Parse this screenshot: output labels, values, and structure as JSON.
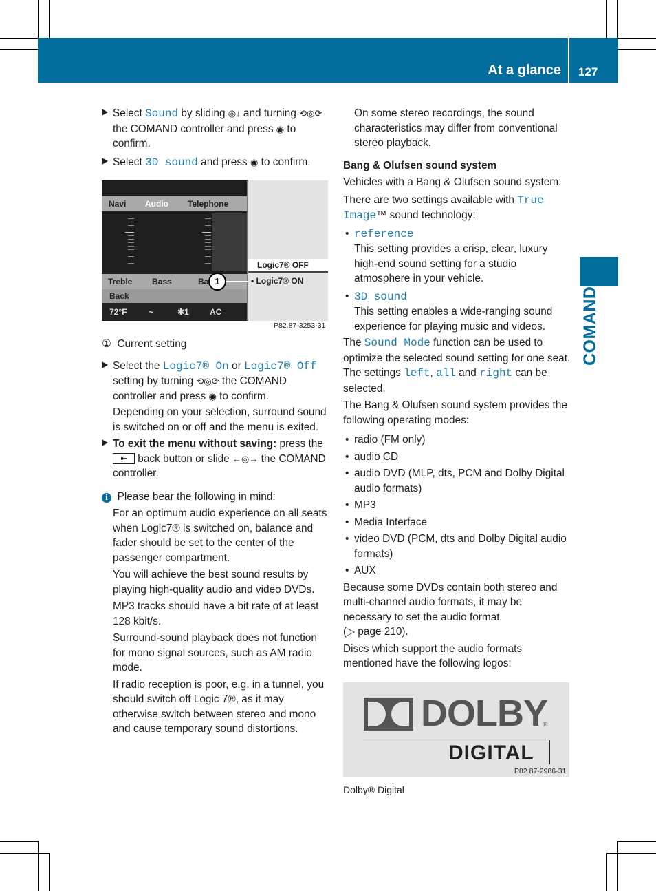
{
  "header": {
    "section_title": "At a glance",
    "page_number": "127",
    "side_tab_label": "COMAND",
    "accent_color": "#036d9d"
  },
  "left_column": {
    "step1": {
      "pre": "Select ",
      "link": "Sound",
      "mid": " by sliding ",
      "post": " and turning ",
      "post2": " the COMAND controller and press ",
      "post3": " to confirm."
    },
    "step2": {
      "pre": "Select ",
      "link": "3D sound",
      "post": " and press ",
      "post2": " to confirm."
    },
    "figure": {
      "tabs": [
        "Navi",
        "Audio",
        "Telephone"
      ],
      "bottom_menu": [
        "Treble",
        "Bass",
        "Bal/Fa"
      ],
      "back_label": "Back",
      "climate": [
        "72°F",
        "~",
        "✱1",
        "AC"
      ],
      "options": [
        "Logic7® OFF",
        "• Logic7® ON"
      ],
      "callout": "1",
      "code": "P82.87-3253-31"
    },
    "legend": {
      "num": "①",
      "text": "Current setting"
    },
    "step3": {
      "pre": "Select the ",
      "link1": "Logic7® On",
      "mid": " or ",
      "link2": "Logic7® Off",
      "post": " setting by turning ",
      "post2": " the COMAND controller and press ",
      "post3": " to confirm.",
      "para": "Depending on your selection, surround sound is switched on or off and the menu is exited."
    },
    "step4": {
      "bold": "To exit the menu without saving:",
      "pre": " press the ",
      "post": " back button or slide ",
      "post2": " the COMAND controller."
    },
    "info": {
      "heading": "Please bear the following in mind:",
      "paragraphs": [
        "For an optimum audio experience on all seats when Logic7® is switched on, balance and fader should be set to the center of the passenger compartment.",
        "You will achieve the best sound results by playing high-quality audio and video DVDs.",
        "MP3 tracks should have a bit rate of at least 128 kbit/s.",
        "Surround-sound playback does not function for mono signal sources, such as AM radio mode.",
        "If radio reception is poor, e.g. in a tunnel, you should switch off Logic 7®, as it may otherwise switch between stereo and mono and cause temporary sound distortions."
      ]
    }
  },
  "right_column": {
    "intro": "On some stereo recordings, the sound characteristics may differ from conventional stereo playback.",
    "heading": "Bang & Olufsen sound system",
    "vehicles": "Vehicles with a Bang & Olufsen sound system:",
    "two_settings": {
      "pre": "There are two settings available with ",
      "link": "True Image",
      "post": "™ sound technology:"
    },
    "settings": [
      {
        "name": "reference",
        "desc": "This setting provides a crisp, clear, luxury high-end sound setting for a studio atmosphere in your vehicle."
      },
      {
        "name": "3D sound",
        "desc": "This setting enables a wide-ranging sound experience for playing music and videos."
      }
    ],
    "sound_mode": {
      "pre": "The ",
      "link": "Sound Mode",
      "mid": " function can be used to optimize the selected sound setting for one seat. The settings ",
      "l1": "left",
      "c": ", ",
      "l2": "all",
      "and": " and ",
      "l3": "right",
      "post": " can be selected."
    },
    "modes_intro": "The Bang & Olufsen sound system provides the following operating modes:",
    "modes": [
      "radio (FM only)",
      "audio CD",
      "audio DVD (MLP, dts, PCM and Dolby Digital audio formats)",
      "MP3",
      "Media Interface",
      "video DVD (PCM, dts and Dolby Digital audio formats)",
      "AUX"
    ],
    "dvd_note": "Because some DVDs contain both stereo and multi-channel audio formats, it may be necessary to set the audio format",
    "page_ref": "(▷ page 210).",
    "discs_note": "Discs which support the audio formats mentioned have the following logos:",
    "logo": {
      "top": "DOLBY",
      "bottom": "DIGITAL",
      "code": "P82.87-2986-31"
    },
    "caption": "Dolby® Digital"
  }
}
